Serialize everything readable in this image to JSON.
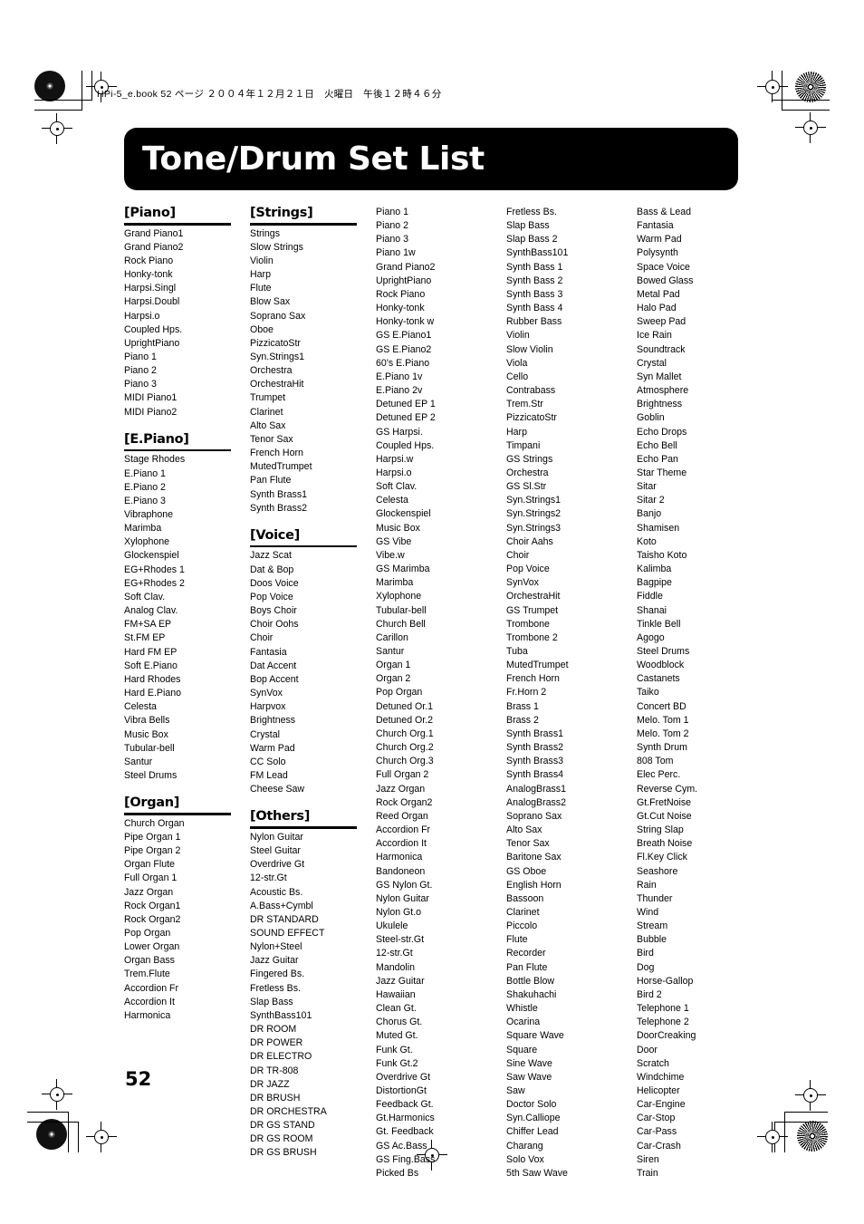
{
  "page": {
    "filestamp": "HPi-5_e.book 52 ページ ２００４年１２月２１日　火曜日　午後１２時４６分",
    "title": "Tone/Drum Set List",
    "page_number": "52"
  },
  "columns": [
    {
      "groups": [
        {
          "heading": "[Piano]",
          "items": [
            "Grand Piano1",
            "Grand Piano2",
            "Rock Piano",
            "Honky-tonk",
            "Harpsi.Singl",
            "Harpsi.Doubl",
            "Harpsi.o",
            "Coupled Hps.",
            "UprightPiano",
            "Piano 1",
            "Piano 2",
            "Piano 3",
            "MIDI Piano1",
            "MIDI Piano2"
          ]
        },
        {
          "heading": "[E.Piano]",
          "items": [
            "Stage Rhodes",
            "E.Piano 1",
            "E.Piano 2",
            "E.Piano 3",
            "Vibraphone",
            "Marimba",
            "Xylophone",
            "Glockenspiel",
            "EG+Rhodes 1",
            "EG+Rhodes 2",
            "Soft Clav.",
            "Analog Clav.",
            "FM+SA EP",
            "St.FM EP",
            "Hard FM EP",
            "Soft E.Piano",
            "Hard Rhodes",
            "Hard E.Piano",
            "Celesta",
            "Vibra Bells",
            "Music Box",
            "Tubular-bell",
            "Santur",
            "Steel Drums"
          ]
        },
        {
          "heading": "[Organ]",
          "items": [
            "Church Organ",
            "Pipe Organ 1",
            "Pipe Organ 2",
            "Organ Flute",
            "Full Organ 1",
            "Jazz Organ",
            "Rock Organ1",
            "Rock Organ2",
            "Pop Organ",
            "Lower Organ",
            "Organ Bass",
            "Trem.Flute",
            "Accordion Fr",
            "Accordion It",
            "Harmonica"
          ]
        }
      ]
    },
    {
      "groups": [
        {
          "heading": "[Strings]",
          "items": [
            "Strings",
            "Slow Strings",
            "Violin",
            "Harp",
            "Flute",
            "Blow Sax",
            "Soprano Sax",
            "Oboe",
            "PizzicatoStr",
            "Syn.Strings1",
            "Orchestra",
            "OrchestraHit",
            "Trumpet",
            "Clarinet",
            "Alto Sax",
            "Tenor Sax",
            "French Horn",
            "MutedTrumpet",
            "Pan Flute",
            "Synth Brass1",
            "Synth Brass2"
          ]
        },
        {
          "heading": "[Voice]",
          "items": [
            "Jazz Scat",
            "Dat & Bop",
            "Doos Voice",
            "Pop Voice",
            "Boys Choir",
            "Choir Oohs",
            "Choir",
            "Fantasia",
            "Dat Accent",
            "Bop Accent",
            "SynVox",
            "Harpvox",
            "Brightness",
            "Crystal",
            "Warm Pad",
            "CC Solo",
            "FM Lead",
            "Cheese Saw"
          ]
        },
        {
          "heading": "[Others]",
          "items": [
            "Nylon Guitar",
            "Steel Guitar",
            "Overdrive Gt",
            "12-str.Gt",
            "Acoustic Bs.",
            "A.Bass+Cymbl",
            "DR STANDARD",
            "SOUND EFFECT",
            "Nylon+Steel",
            "Jazz Guitar",
            "Fingered Bs.",
            "Fretless Bs.",
            "Slap Bass",
            "SynthBass101",
            "DR ROOM",
            "DR POWER",
            "DR ELECTRO",
            "DR TR-808",
            "DR JAZZ",
            "DR BRUSH",
            "DR ORCHESTRA",
            "DR GS STAND",
            "DR GS ROOM",
            "DR GS BRUSH"
          ]
        }
      ]
    },
    {
      "groups": [
        {
          "heading": "",
          "items": [
            "Piano 1",
            "Piano 2",
            "Piano 3",
            "Piano 1w",
            "Grand Piano2",
            "UprightPiano",
            "Rock Piano",
            "Honky-tonk",
            "Honky-tonk w",
            "GS E.Piano1",
            "GS E.Piano2",
            "60's E.Piano",
            "E.Piano 1v",
            "E.Piano 2v",
            "Detuned EP 1",
            "Detuned EP 2",
            "GS Harpsi.",
            "Coupled Hps.",
            "Harpsi.w",
            "Harpsi.o",
            "Soft Clav.",
            "Celesta",
            "Glockenspiel",
            "Music Box",
            "GS Vibe",
            "Vibe.w",
            "GS Marimba",
            "Marimba",
            "Xylophone",
            "Tubular-bell",
            "Church Bell",
            "Carillon",
            "Santur",
            "Organ 1",
            "Organ 2",
            "Pop Organ",
            "Detuned Or.1",
            "Detuned Or.2",
            "Church Org.1",
            "Church Org.2",
            "Church Org.3",
            "Full Organ 2",
            "Jazz Organ",
            "Rock Organ2",
            "Reed Organ",
            "Accordion Fr",
            "Accordion It",
            "Harmonica",
            "Bandoneon",
            "GS Nylon Gt.",
            "Nylon Guitar",
            "Nylon Gt.o",
            "Ukulele",
            "Steel-str.Gt",
            "12-str.Gt",
            "Mandolin",
            "Jazz Guitar",
            "Hawaiian",
            "Clean Gt.",
            "Chorus Gt.",
            "Muted Gt.",
            "Funk Gt.",
            "Funk Gt.2",
            "Overdrive Gt",
            "DistortionGt",
            "Feedback Gt.",
            "Gt.Harmonics",
            "Gt. Feedback",
            "GS Ac.Bass",
            "GS Fing.Bass",
            "Picked Bs"
          ]
        }
      ]
    },
    {
      "groups": [
        {
          "heading": "",
          "items": [
            "Fretless Bs.",
            "Slap Bass",
            "Slap Bass 2",
            "SynthBass101",
            "Synth Bass 1",
            "Synth Bass 2",
            "Synth Bass 3",
            "Synth Bass 4",
            "Rubber Bass",
            "Violin",
            "Slow Violin",
            "Viola",
            "Cello",
            "Contrabass",
            "Trem.Str",
            "PizzicatoStr",
            "Harp",
            "Timpani",
            "GS Strings",
            "Orchestra",
            "GS Sl.Str",
            "Syn.Strings1",
            "Syn.Strings2",
            "Syn.Strings3",
            "Choir Aahs",
            "Choir",
            "Pop Voice",
            "SynVox",
            "OrchestraHit",
            "GS Trumpet",
            "Trombone",
            "Trombone 2",
            "Tuba",
            "MutedTrumpet",
            "French Horn",
            "Fr.Horn 2",
            "Brass 1",
            "Brass 2",
            "Synth Brass1",
            "Synth Brass2",
            "Synth Brass3",
            "Synth Brass4",
            "AnalogBrass1",
            "AnalogBrass2",
            "Soprano Sax",
            "Alto Sax",
            "Tenor Sax",
            "Baritone Sax",
            "GS Oboe",
            "English Horn",
            "Bassoon",
            "Clarinet",
            "Piccolo",
            "Flute",
            "Recorder",
            "Pan Flute",
            "Bottle Blow",
            "Shakuhachi",
            "Whistle",
            "Ocarina",
            "Square Wave",
            "Square",
            "Sine Wave",
            "Saw Wave",
            "Saw",
            "Doctor Solo",
            "Syn.Calliope",
            "Chiffer Lead",
            "Charang",
            "Solo Vox",
            "5th Saw Wave"
          ]
        }
      ]
    },
    {
      "groups": [
        {
          "heading": "",
          "items": [
            "Bass & Lead",
            "Fantasia",
            "Warm Pad",
            "Polysynth",
            "Space Voice",
            "Bowed Glass",
            "Metal Pad",
            "Halo Pad",
            "Sweep Pad",
            "Ice Rain",
            "Soundtrack",
            "Crystal",
            "Syn Mallet",
            "Atmosphere",
            "Brightness",
            "Goblin",
            "Echo Drops",
            "Echo Bell",
            "Echo Pan",
            "Star Theme",
            "Sitar",
            "Sitar 2",
            "Banjo",
            "Shamisen",
            "Koto",
            "Taisho Koto",
            "Kalimba",
            "Bagpipe",
            "Fiddle",
            "Shanai",
            "Tinkle Bell",
            "Agogo",
            "Steel Drums",
            "Woodblock",
            "Castanets",
            "Taiko",
            "Concert BD",
            "Melo. Tom 1",
            "Melo. Tom 2",
            "Synth Drum",
            "808 Tom",
            "Elec Perc.",
            "Reverse Cym.",
            "Gt.FretNoise",
            "Gt.Cut Noise",
            "String Slap",
            "Breath Noise",
            "Fl.Key Click",
            "Seashore",
            "Rain",
            "Thunder",
            "Wind",
            "Stream",
            "Bubble",
            "Bird",
            "Dog",
            "Horse-Gallop",
            "Bird 2",
            "Telephone 1",
            "Telephone 2",
            "DoorCreaking",
            "Door",
            "Scratch",
            "Windchime",
            "Helicopter",
            "Car-Engine",
            "Car-Stop",
            "Car-Pass",
            "Car-Crash",
            "Siren",
            "Train"
          ]
        }
      ]
    }
  ]
}
